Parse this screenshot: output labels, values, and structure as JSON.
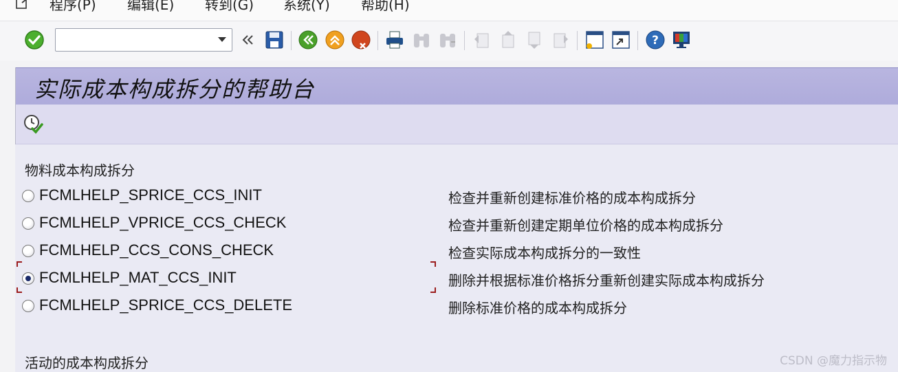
{
  "menu": {
    "items": [
      "程序(P)",
      "编辑(E)",
      "转到(G)",
      "系统(Y)",
      "帮助(H)"
    ]
  },
  "toolbar": {
    "command_value": "",
    "command_placeholder": ""
  },
  "title": "实际成本构成拆分的帮助台",
  "sections": [
    {
      "label": "物料成本构成拆分"
    },
    {
      "label": "活动的成本构成拆分"
    }
  ],
  "options": [
    {
      "name": "FCMLHELP_SPRICE_CCS_INIT",
      "desc": "检查并重新创建标准价格的成本构成拆分",
      "checked": false
    },
    {
      "name": "FCMLHELP_VPRICE_CCS_CHECK",
      "desc": "检查并重新创建定期单位价格的成本构成拆分",
      "checked": false
    },
    {
      "name": "FCMLHELP_CCS_CONS_CHECK",
      "desc": "检查实际成本构成拆分的一致性",
      "checked": false
    },
    {
      "name": "FCMLHELP_MAT_CCS_INIT",
      "desc": "删除并根据标准价格拆分重新创建实际成本构成拆分",
      "checked": true
    },
    {
      "name": "FCMLHELP_SPRICE_CCS_DELETE",
      "desc": "删除标准价格的成本构成拆分",
      "checked": false
    }
  ],
  "watermark": "CSDN @魔力指示物",
  "colors": {
    "title_bar": "#b3b0dd",
    "app_toolbar": "#dedcf0",
    "content_bg": "#eaeaf4",
    "focus_corner": "#9b1c1c"
  },
  "icons": [
    "check-icon",
    "back-icon",
    "save-icon",
    "go-back-icon",
    "exit-icon",
    "cancel-icon",
    "print-icon",
    "find-icon",
    "find-next-icon",
    "first-page-icon",
    "previous-page-icon",
    "next-page-icon",
    "last-page-icon",
    "create-session-icon",
    "shortcut-icon",
    "help-icon",
    "customize-layout-icon",
    "execute-icon"
  ]
}
